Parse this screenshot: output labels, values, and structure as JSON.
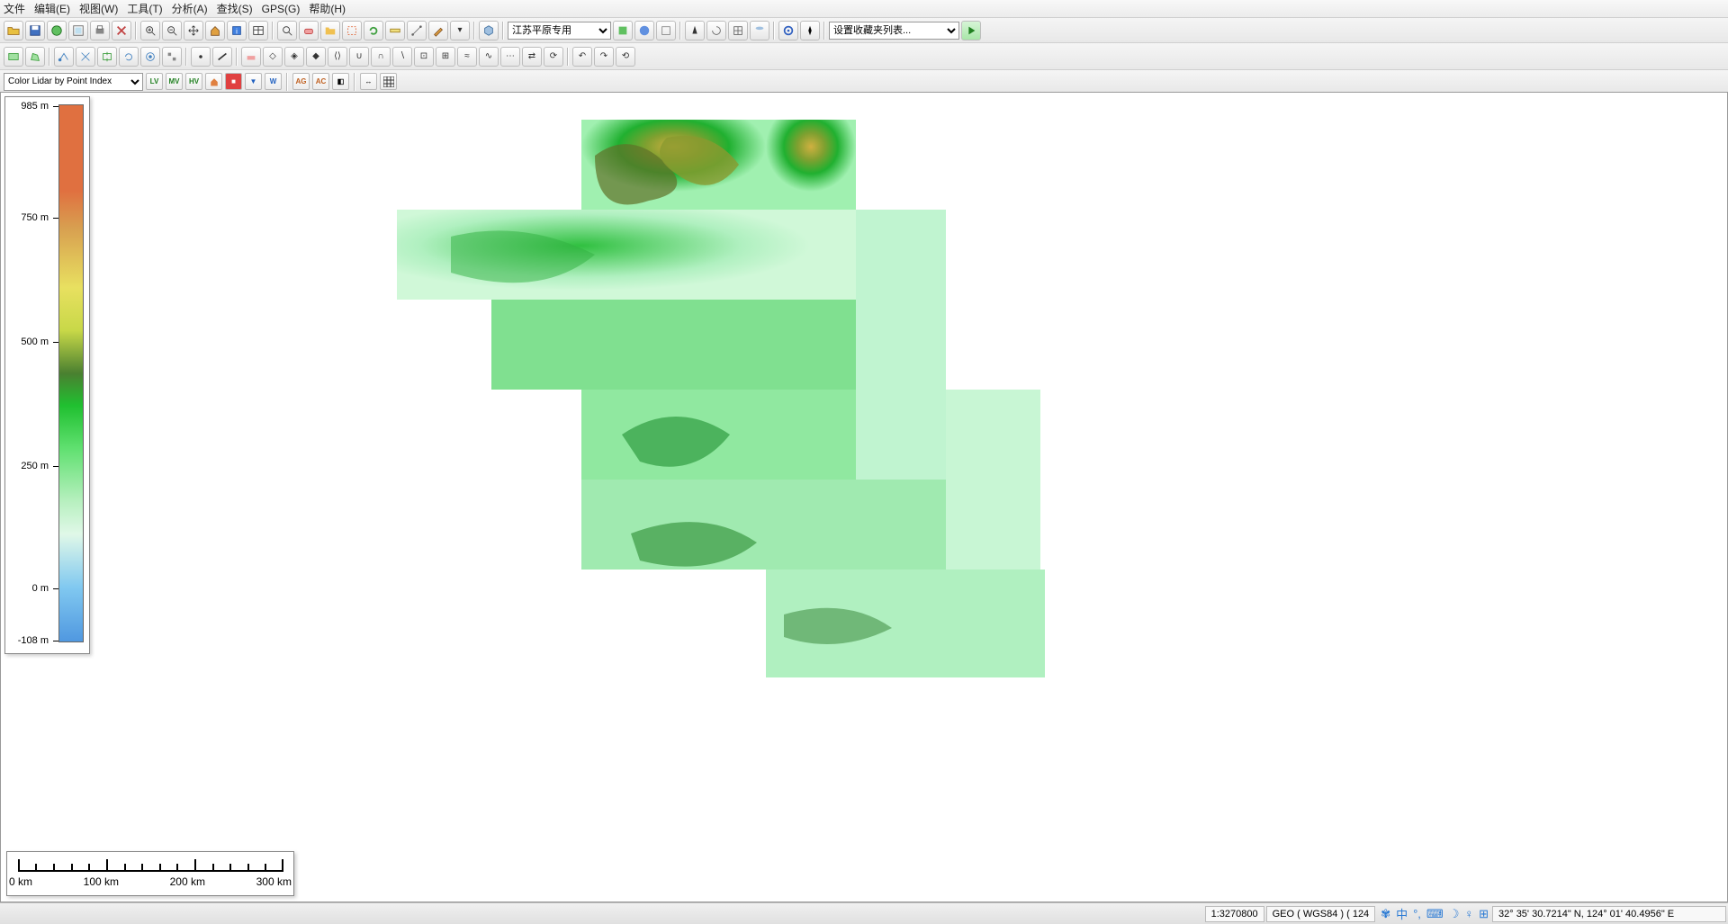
{
  "menu": {
    "file": "文件",
    "edit": "编辑(E)",
    "view": "视图(W)",
    "tools": "工具(T)",
    "analysis": "分析(A)",
    "search": "查找(S)",
    "gps": "GPS(G)",
    "help": "帮助(H)"
  },
  "toolbar1": {
    "config_combo": "江苏平原专用",
    "favorites_combo": "设置收藏夹列表..."
  },
  "lidar": {
    "mode_combo": "Color Lidar by Point Index",
    "btn_lv": "LV",
    "btn_mv": "MV",
    "btn_hv": "HV",
    "btn_w": "W",
    "btn_ag": "AG",
    "btn_ac": "AC"
  },
  "legend": {
    "labels": [
      "985 m",
      "750 m",
      "500 m",
      "250 m",
      "0 m",
      "-108 m"
    ],
    "positions": [
      1,
      22,
      45,
      70,
      91,
      100
    ]
  },
  "scalebar": {
    "labels": [
      "0 km",
      "100 km",
      "200 km",
      "300 km"
    ]
  },
  "status": {
    "scale": "1:3270800",
    "proj": "GEO ( WGS84 ) ( 124",
    "coords": "32° 35' 30.7214\" N, 124° 01' 40.4956\" E"
  },
  "tray": {
    "ime": "中"
  }
}
